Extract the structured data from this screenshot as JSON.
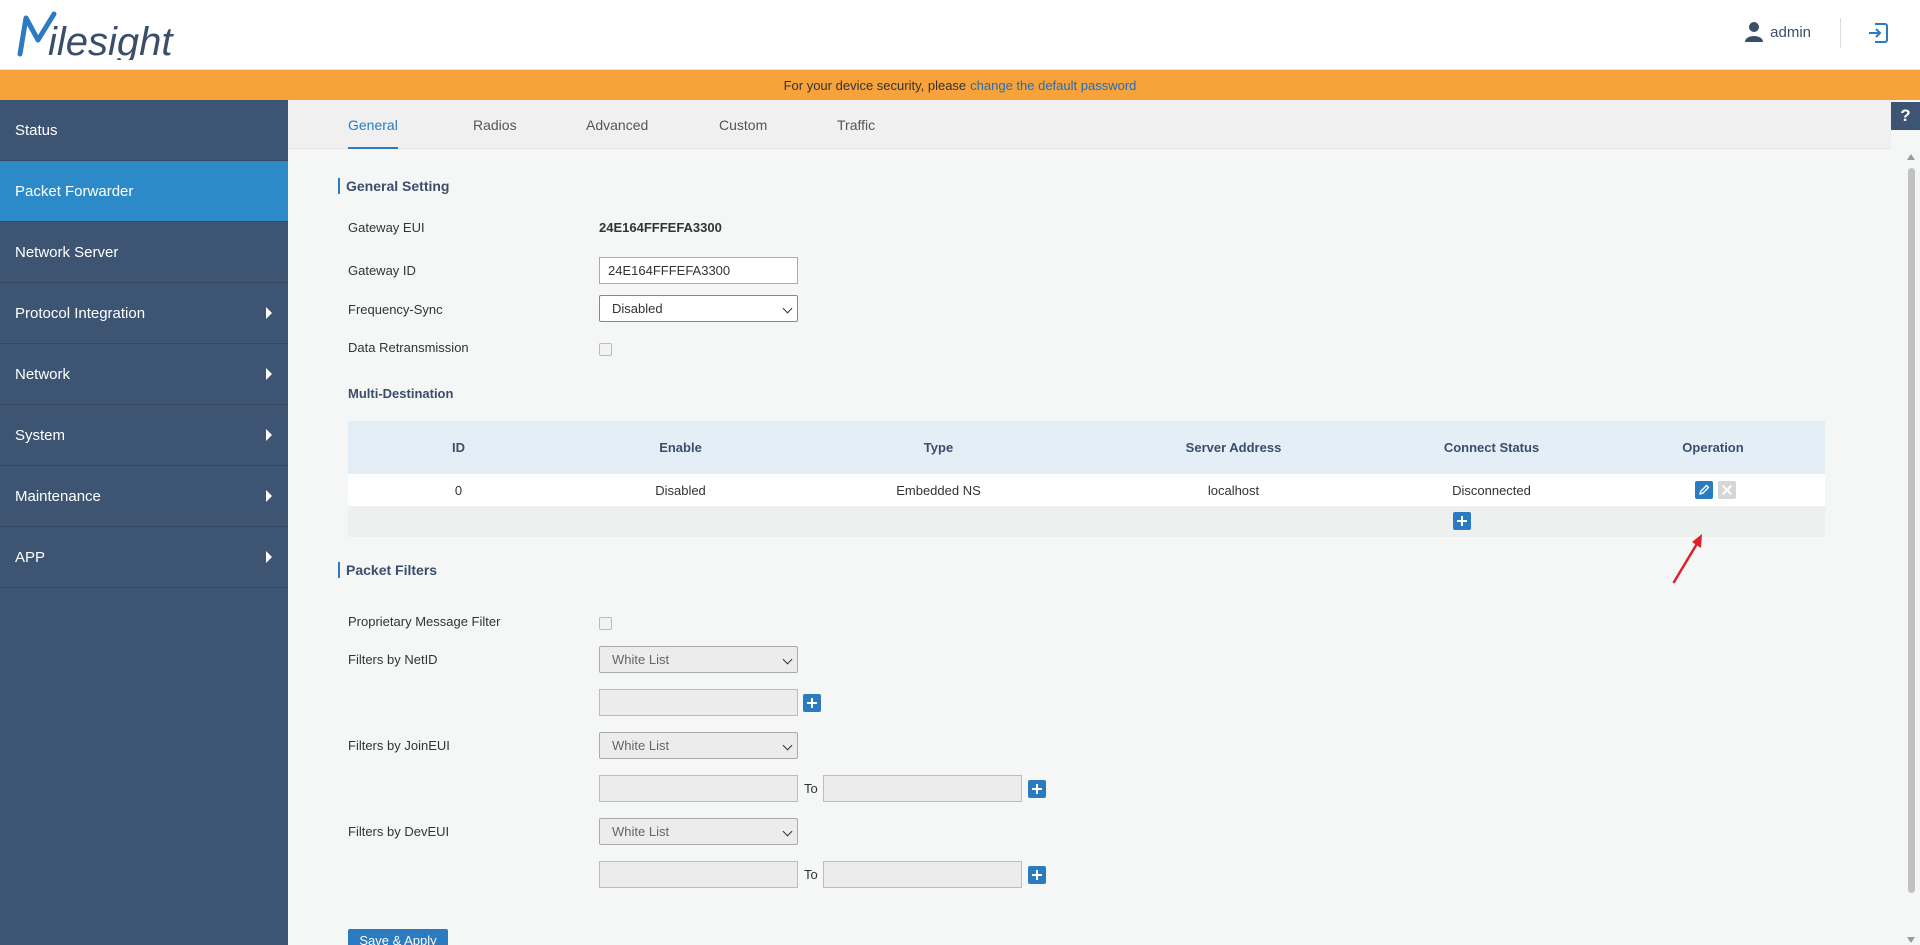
{
  "header": {
    "brand": "Milesight",
    "user": "admin"
  },
  "banner": {
    "text": "For your device security, please",
    "link": "change the default password"
  },
  "sidebar": {
    "items": [
      {
        "label": "Status",
        "active": false,
        "has_submenu": false
      },
      {
        "label": "Packet Forwarder",
        "active": true,
        "has_submenu": false
      },
      {
        "label": "Network Server",
        "active": false,
        "has_submenu": false
      },
      {
        "label": "Protocol Integration",
        "active": false,
        "has_submenu": true
      },
      {
        "label": "Network",
        "active": false,
        "has_submenu": true
      },
      {
        "label": "System",
        "active": false,
        "has_submenu": true
      },
      {
        "label": "Maintenance",
        "active": false,
        "has_submenu": true
      },
      {
        "label": "APP",
        "active": false,
        "has_submenu": true
      }
    ]
  },
  "tabs": [
    {
      "label": "General",
      "active": true
    },
    {
      "label": "Radios",
      "active": false
    },
    {
      "label": "Advanced",
      "active": false
    },
    {
      "label": "Custom",
      "active": false
    },
    {
      "label": "Traffic",
      "active": false
    }
  ],
  "help": "?",
  "general_setting": {
    "title": "General Setting",
    "gateway_eui_label": "Gateway EUI",
    "gateway_eui_value": "24E164FFFEFA3300",
    "gateway_id_label": "Gateway ID",
    "gateway_id_value": "24E164FFFEFA3300",
    "frequency_sync_label": "Frequency-Sync",
    "frequency_sync_value": "Disabled",
    "data_retransmission_label": "Data Retransmission",
    "data_retransmission_checked": false
  },
  "multi_destination": {
    "title": "Multi-Destination",
    "columns": [
      "ID",
      "Enable",
      "Type",
      "Server Address",
      "Connect Status",
      "Operation"
    ],
    "rows": [
      {
        "id": "0",
        "enable": "Disabled",
        "type": "Embedded NS",
        "server_address": "localhost",
        "connect_status": "Disconnected"
      }
    ]
  },
  "packet_filters": {
    "title": "Packet Filters",
    "proprietary_label": "Proprietary Message Filter",
    "proprietary_checked": false,
    "netid_label": "Filters by NetID",
    "netid_mode": "White List",
    "joineui_label": "Filters by JoinEUI",
    "joineui_mode": "White List",
    "joineui_to": "To",
    "deveui_label": "Filters by DevEUI",
    "deveui_mode": "White List",
    "deveui_to": "To"
  },
  "save_apply": "Save & Apply",
  "colors": {
    "sidebar": "#3d5573",
    "active": "#2c8ac8",
    "banner": "#f7a23b",
    "accent": "#2c7bc0",
    "annotation_arrow": "#e0202a"
  },
  "icons": [
    "user-icon",
    "logout-icon",
    "edit-icon",
    "delete-icon",
    "add-icon",
    "help-icon"
  ]
}
